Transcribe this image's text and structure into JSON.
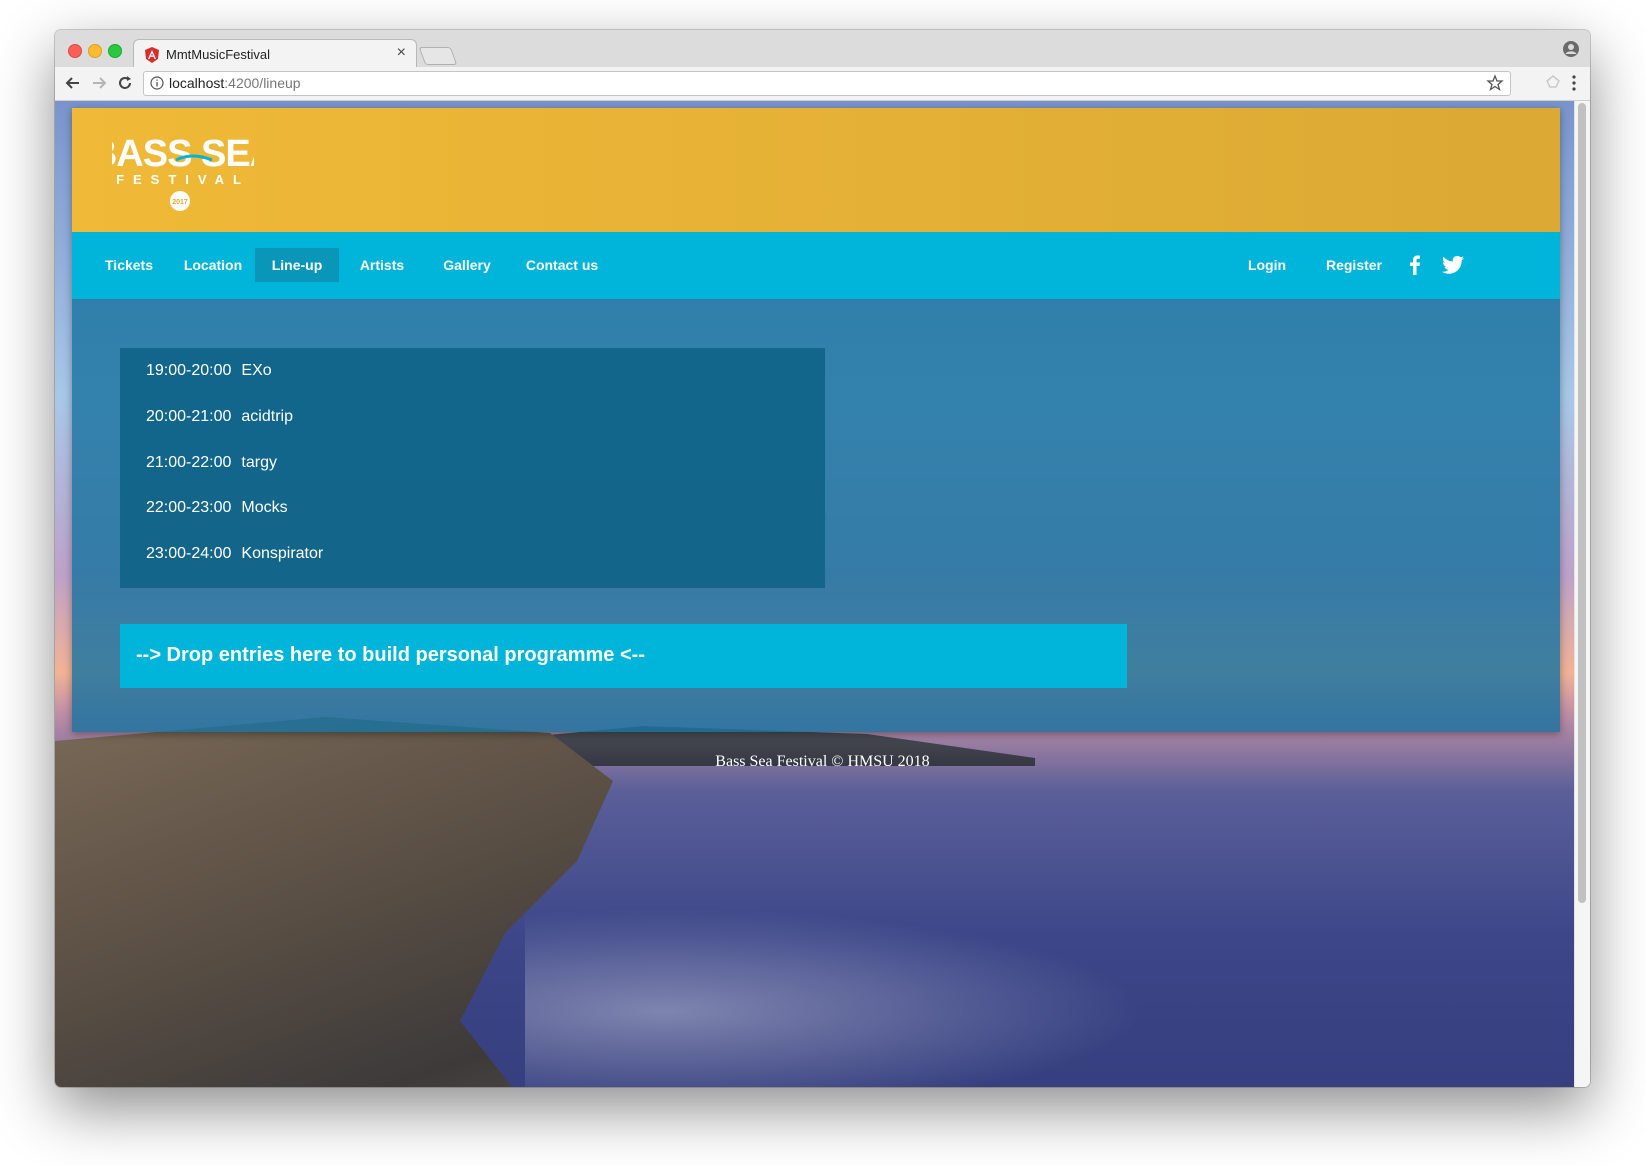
{
  "browser": {
    "tab_title": "MmtMusicFestival",
    "tab_close": "×",
    "url_host": "localhost",
    "url_path": ":4200/lineup"
  },
  "header": {
    "logo_text_top": "BASS SEA",
    "logo_text_bottom": "FESTIVAL",
    "logo_year": "2017",
    "background": "#f0b937"
  },
  "nav": {
    "items": [
      {
        "label": "Tickets"
      },
      {
        "label": "Location"
      },
      {
        "label": "Line-up"
      },
      {
        "label": "Artists"
      },
      {
        "label": "Gallery"
      },
      {
        "label": "Contact us"
      }
    ],
    "active": "Line-up",
    "right": {
      "login": "Login",
      "register": "Register"
    },
    "social_icons": [
      "facebook-icon",
      "twitter-icon"
    ],
    "background": "#00b5d9"
  },
  "lineup": [
    {
      "time": "19:00-20:00",
      "artist": "EXo"
    },
    {
      "time": "20:00-21:00",
      "artist": "acidtrip"
    },
    {
      "time": "21:00-22:00",
      "artist": "targy"
    },
    {
      "time": "22:00-23:00",
      "artist": "Mocks"
    },
    {
      "time": "23:00-24:00",
      "artist": "Konspirator"
    }
  ],
  "dropzone": {
    "text": "--> Drop entries here to build personal programme <--"
  },
  "footer": {
    "text": "Bass Sea Festival © HMSU 2018"
  }
}
